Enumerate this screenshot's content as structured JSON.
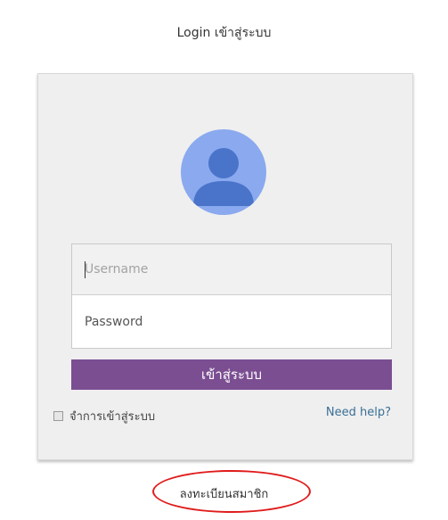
{
  "header": {
    "title": "Login เข้าสู่ระบบ"
  },
  "login_card": {
    "avatar_icon": "user-avatar-icon",
    "username": {
      "value": "",
      "placeholder": "Username"
    },
    "password": {
      "value": "",
      "placeholder": "Password"
    },
    "submit_label": "เข้าสู่ระบบ",
    "remember_label": "จำการเข้าสู่ระบบ",
    "remember_checked": false,
    "help_label": "Need help?"
  },
  "footer": {
    "register_label": "ลงทะเบียนสมาชิก"
  },
  "colors": {
    "accent": "#7b4e92",
    "avatar_bg": "#8aa9ef",
    "avatar_fg": "#4a74c9",
    "link": "#3a6f96",
    "highlight": "#e01b1b"
  }
}
